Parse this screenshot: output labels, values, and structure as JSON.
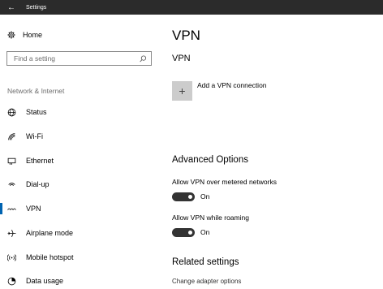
{
  "window": {
    "title": "Settings"
  },
  "sidebar": {
    "home_label": "Home",
    "search_placeholder": "Find a setting",
    "section_label": "Network & Internet",
    "items": [
      {
        "label": "Status",
        "icon": "globe-icon"
      },
      {
        "label": "Wi-Fi",
        "icon": "wifi-icon"
      },
      {
        "label": "Ethernet",
        "icon": "ethernet-icon"
      },
      {
        "label": "Dial-up",
        "icon": "dialup-icon"
      },
      {
        "label": "VPN",
        "icon": "vpn-icon",
        "active": true
      },
      {
        "label": "Airplane mode",
        "icon": "airplane-icon"
      },
      {
        "label": "Mobile hotspot",
        "icon": "hotspot-icon"
      },
      {
        "label": "Data usage",
        "icon": "data-usage-icon"
      }
    ]
  },
  "main": {
    "title": "VPN",
    "subtitle": "VPN",
    "add_label": "Add a VPN connection",
    "advanced_title": "Advanced Options",
    "options": [
      {
        "label": "Allow VPN over metered networks",
        "state": "On"
      },
      {
        "label": "Allow VPN while roaming",
        "state": "On"
      }
    ],
    "related_title": "Related settings",
    "related_link": "Change adapter options"
  },
  "colors": {
    "accent": "#0063b1",
    "titlebar": "#2b2b2b",
    "toggle_on": "#333333"
  }
}
